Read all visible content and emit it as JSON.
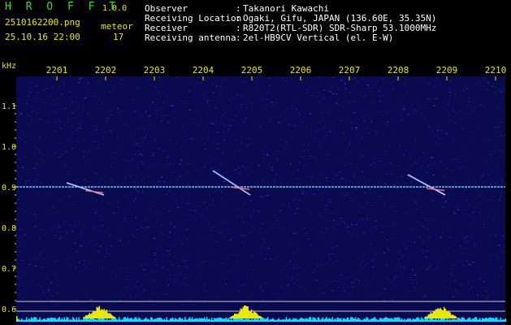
{
  "app": {
    "title": "H R O F F T",
    "version": "1.0.0",
    "filename": "2510162200.png",
    "datetime": "25.10.16 22:00",
    "kind_label": "meteor",
    "count": "17"
  },
  "info": [
    {
      "label": "Observer",
      "value": "Takanori Kawachi"
    },
    {
      "label": "Receiving Location",
      "value": "Ogaki, Gifu, JAPAN (136.60E, 35.35N)"
    },
    {
      "label": "Receiver",
      "value": "R820T2(RTL-SDR) SDR-Sharp 53.1000MHz"
    },
    {
      "label": "Receiving antenna",
      "value": "2el-HB9CV Vertical (el. E-W)"
    }
  ],
  "colors": {
    "background": "#000000",
    "plot_bg": "#0a0a50",
    "label_yellow": "#e8e800",
    "label_green": "#33dd33",
    "carrier": "#8fd0ff",
    "meteor_trace": "#d8f0ff",
    "meteor_core": "#ff7070",
    "level_histogram": "#e8e800",
    "noise_floor": "#00e0ff"
  },
  "chart_data": {
    "type": "heatmap",
    "ylabel": "kHz",
    "x_ticks": [
      "2201",
      "2202",
      "2203",
      "2204",
      "2205",
      "2206",
      "2207",
      "2208",
      "2209",
      "2210"
    ],
    "y_ticks": [
      "1.1",
      "1.0",
      "0.9",
      "0.8",
      "0.7",
      "0.6"
    ],
    "ylim": [
      0.6,
      1.1
    ],
    "carrier_khz": 0.9,
    "meteor_echoes": [
      {
        "start_time": "2201",
        "end_time": "2202",
        "freq_start_khz": 0.91,
        "freq_end_khz": 0.88
      },
      {
        "start_time": "2204",
        "end_time": "2205",
        "freq_start_khz": 0.94,
        "freq_end_khz": 0.88
      },
      {
        "start_time": "2208",
        "end_time": "2209",
        "freq_start_khz": 0.93,
        "freq_end_khz": 0.88
      }
    ]
  }
}
